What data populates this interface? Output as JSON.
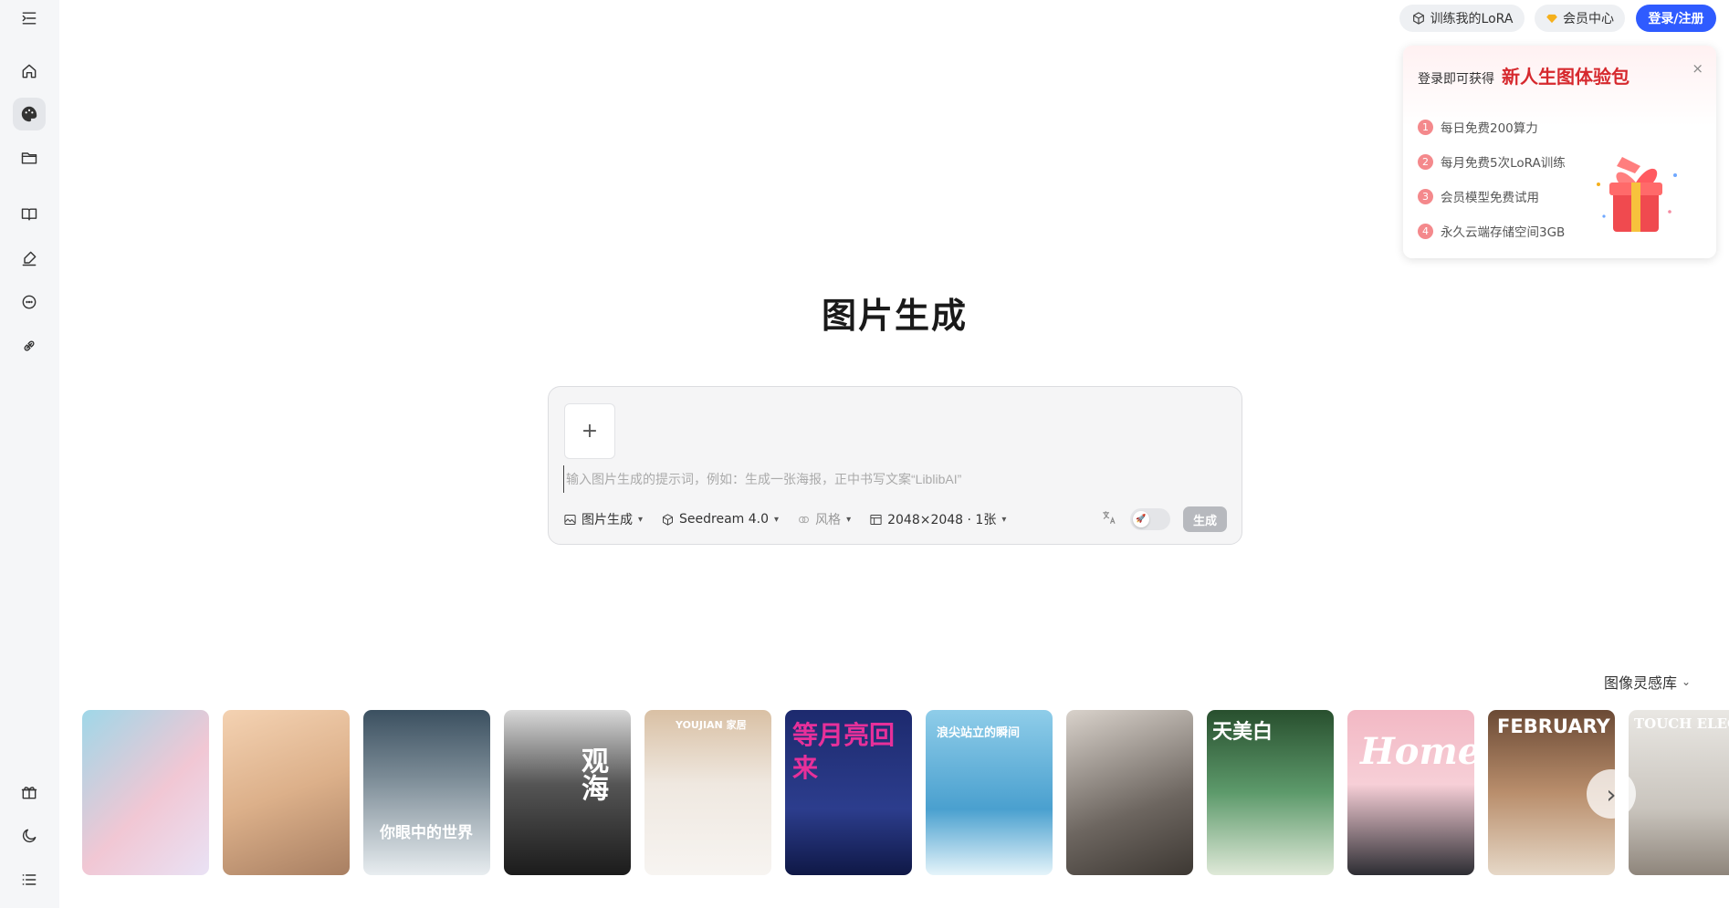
{
  "header": {
    "lora_label": "训练我的LoRA",
    "vip_label": "会员中心",
    "login_label": "登录/注册"
  },
  "promo": {
    "pre_text": "登录即可获得",
    "title": "新人生图体验包",
    "close_glyph": "×",
    "items": [
      {
        "num": "1",
        "text": "每日免费200算力"
      },
      {
        "num": "2",
        "text": "每月免费5次LoRA训练"
      },
      {
        "num": "3",
        "text": "会员模型免费试用"
      },
      {
        "num": "4",
        "text": "永久云端存储空间3GB"
      }
    ]
  },
  "main": {
    "title": "图片生成",
    "upload_glyph": "+",
    "placeholder": "输入图片生成的提示词，例如：生成一张海报，正中书写文案“LiblibAI”",
    "tools": {
      "mode": "图片生成",
      "model": "Seedream 4.0",
      "style": "风格",
      "size": "2048×2048 · 1张"
    },
    "generate_label": "生成"
  },
  "gallery": {
    "title": "图像灵感库",
    "next_glyph": "›",
    "cards": [
      {
        "text": "",
        "bg": "linear-gradient(135deg,#9fd7e8,#f1c7d4 55%,#e9e2f5)"
      },
      {
        "text": "",
        "bg": "linear-gradient(160deg,#f4d2b2,#dcb08a 50%,#a87f62)"
      },
      {
        "text": "你眼中的世界",
        "bg": "linear-gradient(180deg,#3b5060,#7a8a95 40%,#e8edf0)"
      },
      {
        "text": "观海",
        "bg": "linear-gradient(180deg,#d8d8d8,#555 45%,#1b1b1b)"
      },
      {
        "text": "YOUJIAN 家居",
        "bg": "linear-gradient(180deg,#d9c0a4,#efe8e0 45%,#f7f4f1)"
      },
      {
        "text": "等月亮回来",
        "bg": "linear-gradient(180deg,#1d2a6e,#2c3d8d 60%,#0f1846)"
      },
      {
        "text": "浪尖站立的瞬间",
        "bg": "linear-gradient(180deg,#8fcde9,#4aa0cf 60%,#e5f4fa)"
      },
      {
        "text": "",
        "bg": "linear-gradient(160deg,#d9d2cb,#6d6660 60%,#3d3833)"
      },
      {
        "text": "天美白",
        "bg": "linear-gradient(180deg,#284f2e,#5d9a6b 50%,#dfe9d8)"
      },
      {
        "text": "Home",
        "bg": "linear-gradient(180deg,#f2b8c4,#f7cfd7 45%,#2d2d33)"
      },
      {
        "text": "FEBRUARY",
        "bg": "linear-gradient(180deg,#6b4a35,#b98e6c 50%,#e6d8c7)"
      },
      {
        "text": "TOUCH ELEGANCE",
        "bg": "linear-gradient(180deg,#e9e7e3,#c9c4bd 60%,#8e857b)"
      }
    ]
  },
  "colors": {
    "accent": "#2f5bff",
    "promo_red": "#d6292e",
    "sidebar_bg": "#f5f6f8"
  }
}
